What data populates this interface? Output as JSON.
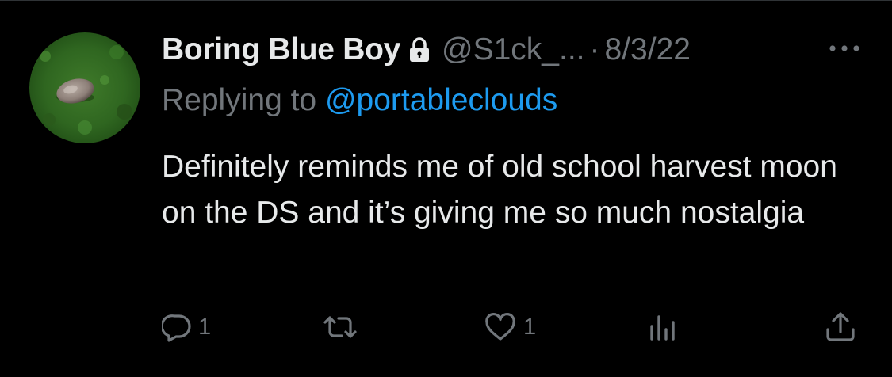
{
  "tweet": {
    "display_name": "Boring Blue Boy",
    "handle": "@S1ck_...",
    "separator": "·",
    "date": "8/3/22",
    "replying_prefix": "Replying to ",
    "replying_to": "@portableclouds",
    "text": "Definitely reminds me of old school harvest moon on the DS and it’s giving me so much nostalgia",
    "protected_icon": "lock-icon",
    "more_icon": "more-horizontal-icon"
  },
  "actions": {
    "reply": {
      "icon": "reply-bubble-icon",
      "count": "1"
    },
    "retweet": {
      "icon": "retweet-icon",
      "count": ""
    },
    "like": {
      "icon": "heart-icon",
      "count": "1"
    },
    "views": {
      "icon": "views-bar-chart-icon",
      "count": ""
    },
    "share": {
      "icon": "share-upload-icon"
    }
  },
  "colors": {
    "background": "#000000",
    "primary_text": "#e7e9ea",
    "secondary_text": "#71767b",
    "link": "#1d9bf0"
  }
}
